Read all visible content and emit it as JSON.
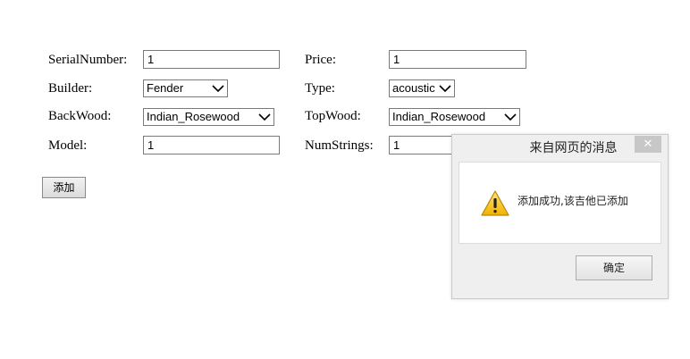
{
  "form": {
    "serial_number": {
      "label": "SerialNumber:",
      "value": "1"
    },
    "price": {
      "label": "Price:",
      "value": "1"
    },
    "builder": {
      "label": "Builder:",
      "value": "Fender"
    },
    "type": {
      "label": "Type:",
      "value": "acoustic"
    },
    "back_wood": {
      "label": "BackWood:",
      "value": "Indian_Rosewood"
    },
    "top_wood": {
      "label": "TopWood:",
      "value": "Indian_Rosewood"
    },
    "model": {
      "label": "Model:",
      "value": "1"
    },
    "num_strings": {
      "label": "NumStrings:",
      "value": "1"
    },
    "add_button": "添加"
  },
  "dialog": {
    "title": "来自网页的消息",
    "close_glyph": "✕",
    "icon": "warning-icon",
    "message": "添加成功,该吉他已添加",
    "ok_button": "确定"
  }
}
